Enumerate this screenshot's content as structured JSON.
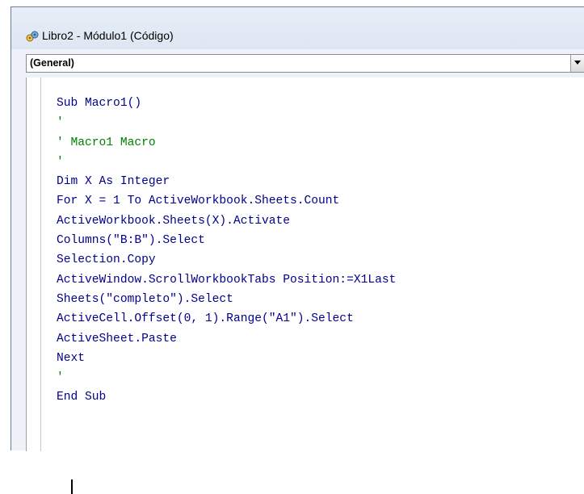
{
  "window": {
    "title": "Libro2 - Módulo1 (Código)",
    "icon": "vba-module-icon"
  },
  "object_combo": {
    "value": "(General)"
  },
  "code_lines": [
    {
      "text": "Sub Macro1()",
      "kind": "code"
    },
    {
      "text": "'",
      "kind": "comment"
    },
    {
      "text": "' Macro1 Macro",
      "kind": "comment"
    },
    {
      "text": "'",
      "kind": "comment"
    },
    {
      "text": "Dim X As Integer",
      "kind": "code"
    },
    {
      "text": "For X = 1 To ActiveWorkbook.Sheets.Count",
      "kind": "code"
    },
    {
      "text": "ActiveWorkbook.Sheets(X).Activate",
      "kind": "code"
    },
    {
      "text": "Columns(\"B:B\").Select",
      "kind": "code"
    },
    {
      "text": "Selection.Copy",
      "kind": "code"
    },
    {
      "text": "ActiveWindow.ScrollWorkbookTabs Position:=X1Last",
      "kind": "code"
    },
    {
      "text": "Sheets(\"completo\").Select",
      "kind": "code"
    },
    {
      "text": "ActiveCell.Offset(0, 1).Range(\"A1\").Select",
      "kind": "code"
    },
    {
      "text": "ActiveSheet.Paste",
      "kind": "code"
    },
    {
      "text": "Next",
      "kind": "code"
    },
    {
      "text": "'",
      "kind": "comment"
    },
    {
      "text": "End Sub",
      "kind": "code"
    }
  ],
  "colors": {
    "code": "#00008b",
    "comment": "#008000"
  }
}
